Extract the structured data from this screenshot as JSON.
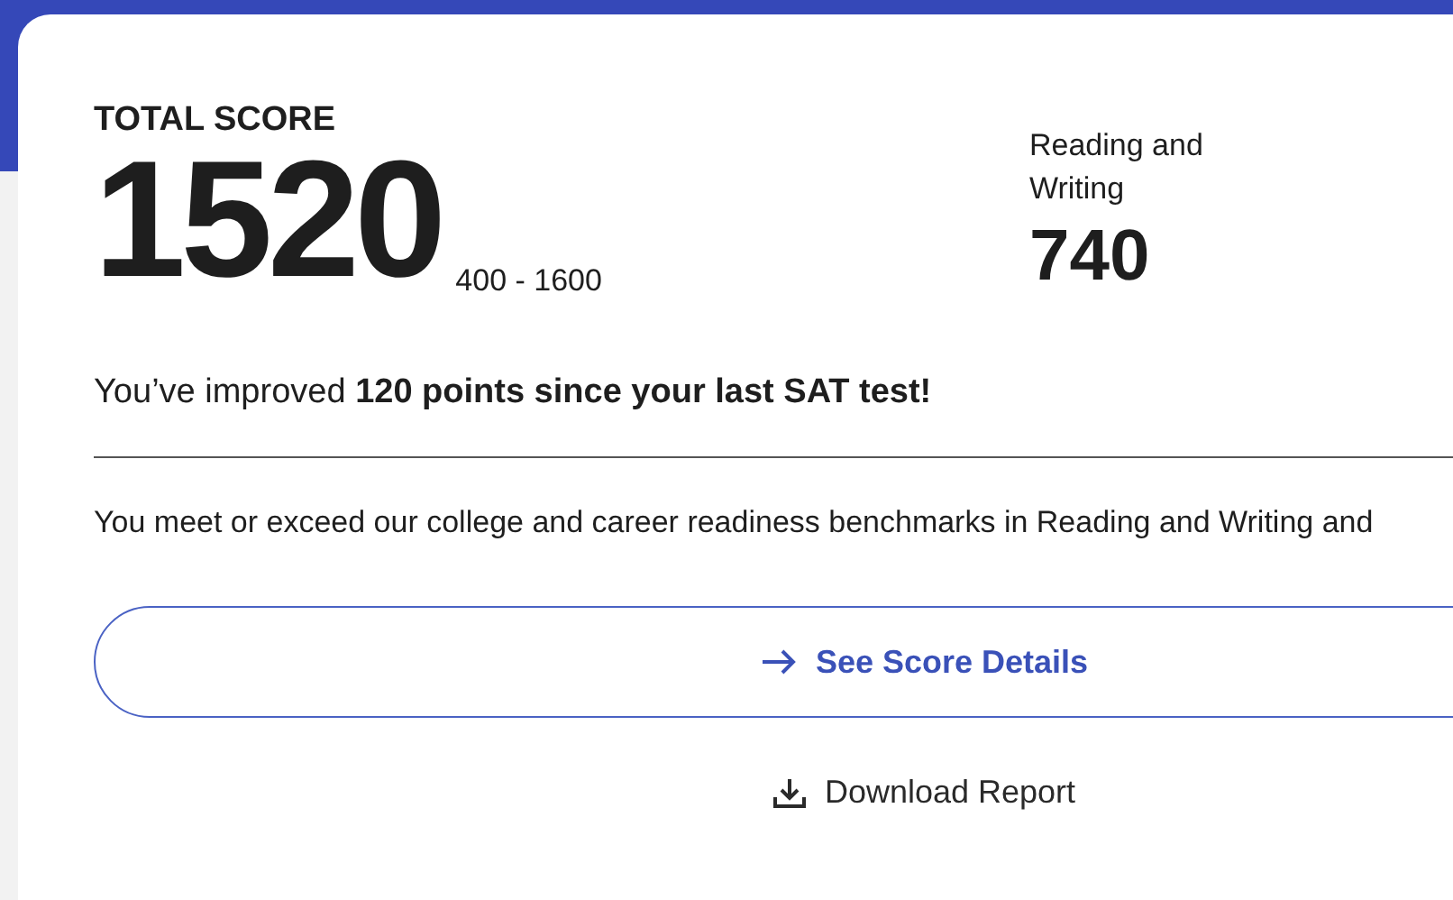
{
  "total_score": {
    "label": "TOTAL SCORE",
    "score": "1520",
    "range": "400 - 1600"
  },
  "section_score": {
    "label": "Reading and Writing",
    "score": "740"
  },
  "improvement": "You’ve improved **120 points since your last SAT test!**",
  "benchmark_text": "You meet or exceed our college and career readiness benchmarks in Reading and Writing and",
  "details_button": {
    "label": "See Score Details"
  },
  "download_link": {
    "label": "Download Report"
  }
}
